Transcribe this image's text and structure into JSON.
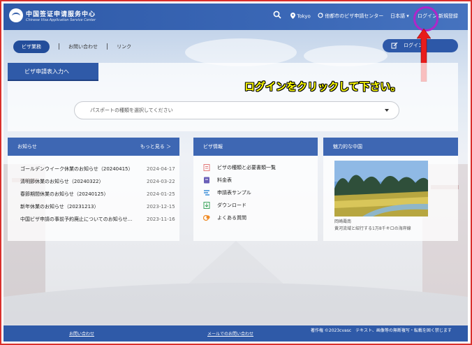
{
  "header": {
    "logo_cn": "中国签证申请服务中心",
    "logo_en": "Chinese Visa Application Service Center",
    "location": "Tokyo",
    "switch_center": "他都市のビザ申請センター",
    "language": "日本語",
    "login": "ログイン",
    "register": "新規登録",
    "search_icon": "search-icon",
    "location_icon": "map-pin-icon",
    "switch_icon": "refresh-icon"
  },
  "subnav": {
    "active": "ビザ業務",
    "contact": "お問い合わせ",
    "links": "リンク",
    "login_pill": "ログイン"
  },
  "visa_panel": {
    "tab": "ビザ申請表入力へ",
    "select_placeholder": "パスポートの種類を選択してください"
  },
  "annotation": {
    "text": "ログインをクリックして下さい。",
    "color": "#ffff00",
    "circle_color": "#b026c9",
    "arrow_color": "#e81c1c"
  },
  "news": {
    "title": "お知らせ",
    "more": "もっと見る ＞",
    "items": [
      {
        "title": "ゴールデンウイーク休業のお知らせ（20240415）",
        "date": "2024-04-17"
      },
      {
        "title": "清明節休業のお知らせ（20240322）",
        "date": "2024-03-22"
      },
      {
        "title": "春節期間休業のお知らせ（20240125）",
        "date": "2024-01-25"
      },
      {
        "title": "新年休業のお知らせ（20231213）",
        "date": "2023-12-15"
      },
      {
        "title": "中国ビザ申請の事前予約廃止についてのお知らせ...",
        "date": "2023-11-16"
      }
    ]
  },
  "visa_info": {
    "title": "ビザ情報",
    "items": [
      {
        "label": "ビザの種類と必要書類一覧",
        "icon": "document-list-icon",
        "color": "#e37a7a"
      },
      {
        "label": "料金表",
        "icon": "price-table-icon",
        "color": "#6a5fb8"
      },
      {
        "label": "申請表サンプル",
        "icon": "sample-form-icon",
        "color": "#3b8ed8"
      },
      {
        "label": "ダウンロード",
        "icon": "download-icon",
        "color": "#3aa35a"
      },
      {
        "label": "よくある質問",
        "icon": "faq-icon",
        "color": "#f08a24"
      }
    ]
  },
  "charm": {
    "title": "魅力的な中国",
    "caption_line1": "岡崎壽南",
    "caption_line2": "黄河流域と紹行する1万8千キロの海岸線"
  },
  "footer": {
    "contact": "お問い合わせ",
    "mail_contact": "メールでのお問い合わせ",
    "copyright": "著作権 ©2023cvasc　テキスト、画像等の無断複写・転載を固く禁じます"
  },
  "colors": {
    "brand_blue": "#2f5aa8",
    "header_blue": "#3a67b6",
    "frame_red": "#d9302c"
  }
}
